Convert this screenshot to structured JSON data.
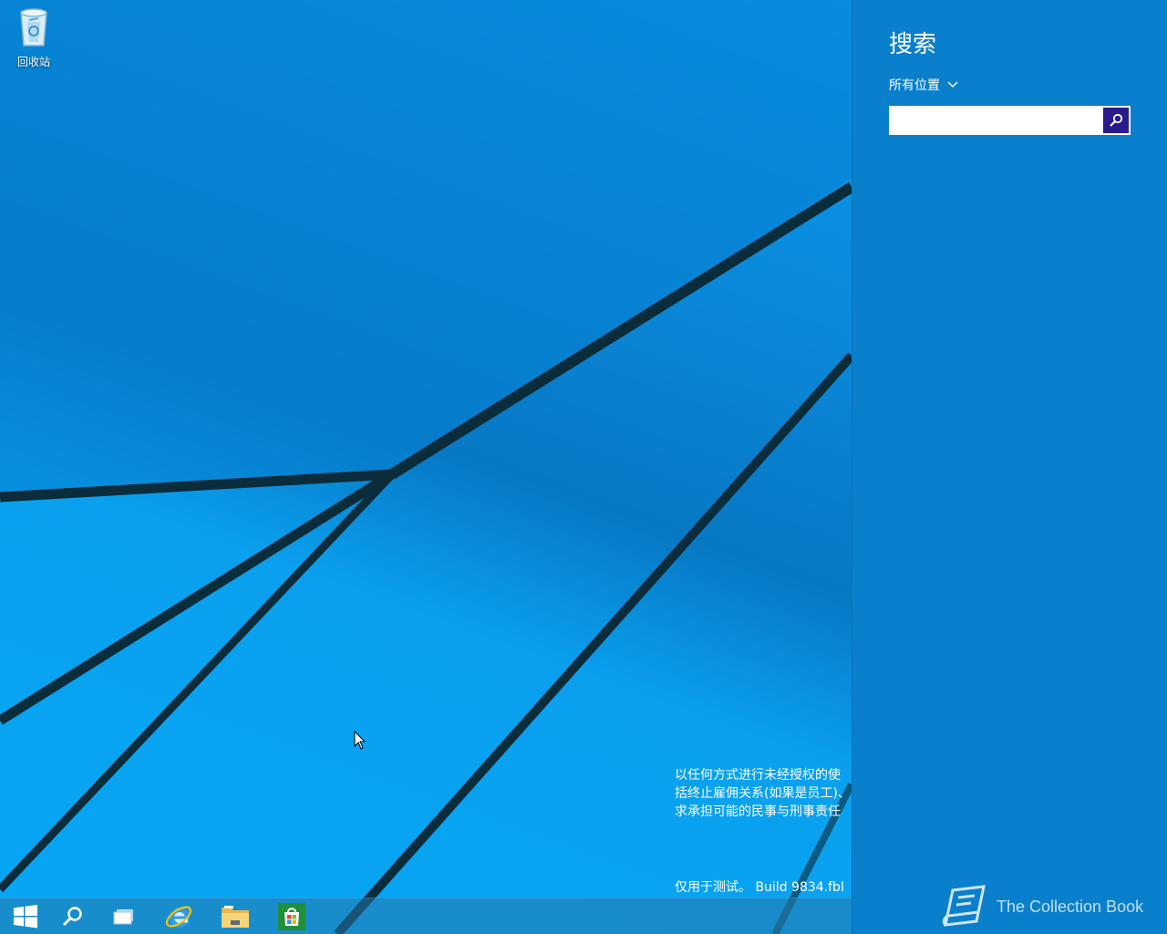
{
  "desktop": {
    "icons": [
      {
        "label": "回收站",
        "icon": "recycle-bin-icon"
      }
    ],
    "watermark_lines": [
      "以任何方式进行未经授权的使",
      "括终止雇佣关系(如果是员工)、",
      "求承担可能的民事与刑事责任"
    ],
    "build_info": "仅用于测试。 Build 9834.fbl"
  },
  "taskbar": {
    "items": [
      {
        "icon": "windows-start-icon"
      },
      {
        "icon": "search-icon"
      },
      {
        "icon": "task-view-icon"
      },
      {
        "icon": "internet-explorer-icon"
      },
      {
        "icon": "file-explorer-icon"
      },
      {
        "icon": "store-icon"
      }
    ]
  },
  "search_pane": {
    "title": "搜索",
    "scope_label": "所有位置",
    "input_value": "",
    "input_placeholder": "",
    "search_button_icon": "magnifier-icon",
    "brand_text": "The Collection Book",
    "colors": {
      "pane_bg": "#0a7fcc",
      "search_button_bg": "#2a1b8c"
    }
  }
}
